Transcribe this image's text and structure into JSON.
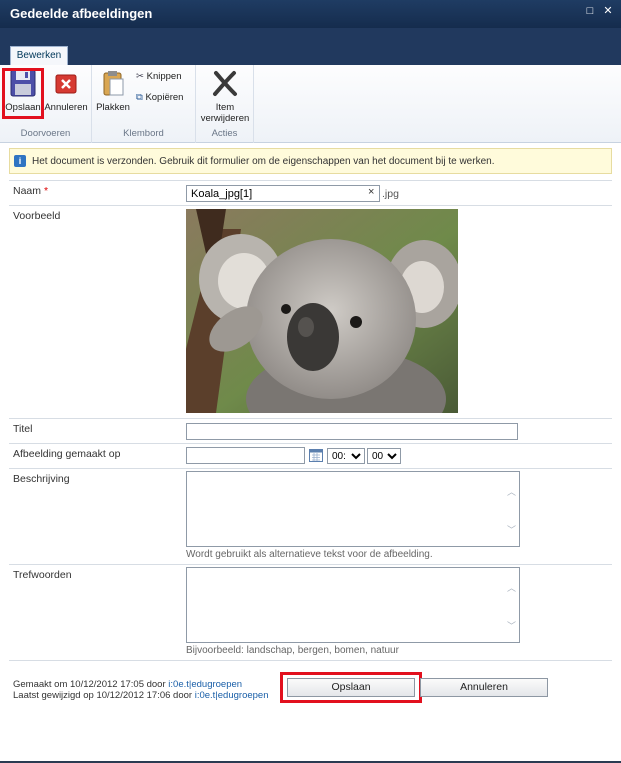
{
  "window": {
    "title": "Gedeelde afbeeldingen",
    "maximize": "□",
    "close": "✕"
  },
  "ribbon": {
    "tab": "Bewerken",
    "groups": [
      {
        "label": "Doorvoeren",
        "buttons": [
          "Opslaan",
          "Annuleren"
        ]
      },
      {
        "label": "Klembord",
        "big": "Plakken",
        "small": [
          "Knippen",
          "Kopiëren"
        ]
      },
      {
        "label": "Acties",
        "big_line1": "Item",
        "big_line2": "verwijderen"
      }
    ]
  },
  "info": {
    "icon": "info-icon",
    "text": "Het document is verzonden. Gebruik dit formulier om de eigenschappen van het document bij te werken."
  },
  "form": {
    "naam": {
      "label": "Naam",
      "required": "*",
      "value": "Koala_jpg[1]",
      "clear": "×",
      "ext": ".jpg"
    },
    "voorbeeld": {
      "label": "Voorbeeld"
    },
    "titel": {
      "label": "Titel",
      "value": ""
    },
    "datum": {
      "label": "Afbeelding gemaakt op",
      "value": "",
      "hour": "00:",
      "minute": "00"
    },
    "beschrijving": {
      "label": "Beschrijving",
      "hint": "Wordt gebruikt als alternatieve tekst voor de afbeelding."
    },
    "trefwoorden": {
      "label": "Trefwoorden",
      "hint": "Bijvoorbeeld: landschap, bergen, bomen, natuur"
    }
  },
  "footer": {
    "created_prefix": "Gemaakt om 10/12/2012 17:05 door",
    "created_by": "i:0e.t|edugroepen",
    "modified_prefix": "Laatst gewijzigd op 10/12/2012 17:06 door",
    "modified_by": "i:0e.t|edugroepen",
    "save": "Opslaan",
    "cancel": "Annuleren"
  },
  "colors": {
    "title_bar": "#1f3c63",
    "highlight": "#e2101e",
    "info_bg": "#fffbdb",
    "link": "#1a5fa8"
  }
}
